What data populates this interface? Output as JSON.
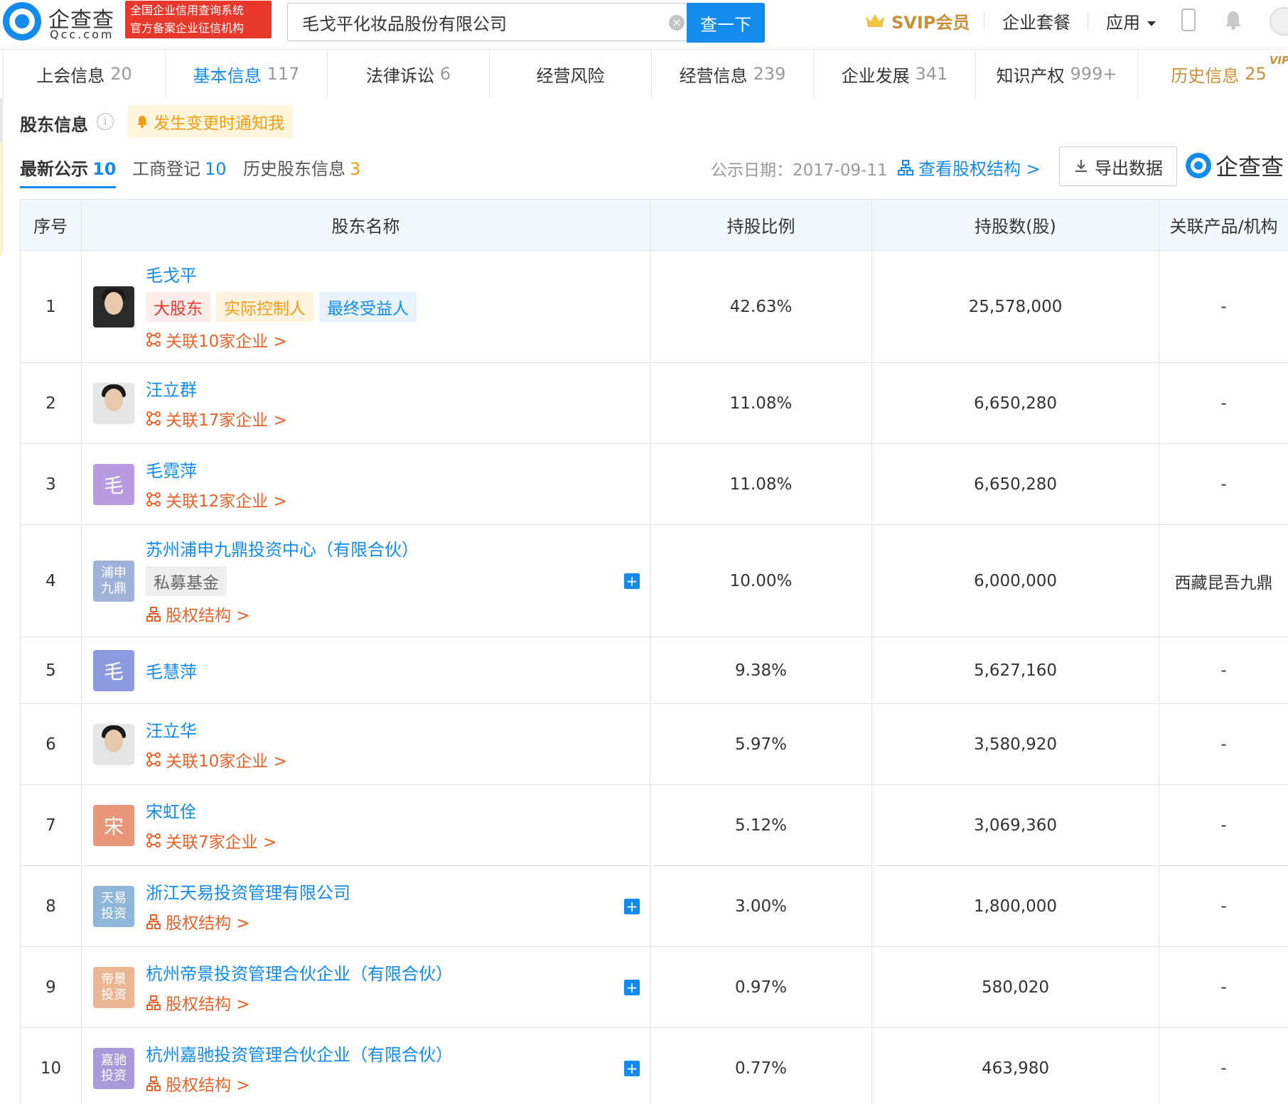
{
  "header": {
    "logo_cn": "企查查",
    "logo_en": "Qcc.com",
    "badge_line1": "全国企业信用查询系统",
    "badge_line2": "官方备案企业征信机构",
    "search_value": "毛戈平化妆品股份有限公司",
    "search_button": "查一下",
    "svip_label": "SVIP会员",
    "package_label": "企业套餐",
    "apps_label": "应用"
  },
  "tabs": [
    {
      "label": "上会信息",
      "count": "20"
    },
    {
      "label": "基本信息",
      "count": "117"
    },
    {
      "label": "法律诉讼",
      "count": "6"
    },
    {
      "label": "经营风险",
      "count": ""
    },
    {
      "label": "经营信息",
      "count": "239"
    },
    {
      "label": "企业发展",
      "count": "341"
    },
    {
      "label": "知识产权",
      "count": "999+"
    },
    {
      "label": "历史信息",
      "count": "25",
      "vip": "VIP"
    }
  ],
  "section": {
    "title": "股东信息",
    "info_symbol": "i",
    "notify": "发生变更时通知我"
  },
  "subtabs": {
    "latest": {
      "label": "最新公示",
      "count": "10"
    },
    "registry": {
      "label": "工商登记",
      "count": "10"
    },
    "history": {
      "label": "历史股东信息",
      "count": "3"
    },
    "date": "公示日期：2017-09-11",
    "equity_link": "查看股权结构 >",
    "export": "导出数据",
    "watermark": "企查查"
  },
  "table": {
    "headers": [
      "序号",
      "股东名称",
      "持股比例",
      "持股数(股)",
      "关联产品/机构"
    ],
    "rows": [
      {
        "idx": "1",
        "name": "毛戈平",
        "tags": [
          {
            "text": "大股东",
            "color": "red"
          },
          {
            "text": "实际控制人",
            "color": "orange"
          },
          {
            "text": "最终受益人",
            "color": "blue"
          }
        ],
        "link": "关联10家企业 >",
        "ratio": "42.63%",
        "shares": "25,578,000",
        "rel": "-",
        "avatar": "photo",
        "plus": false
      },
      {
        "idx": "2",
        "name": "汪立群",
        "tags": [],
        "link": "关联17家企业 >",
        "ratio": "11.08%",
        "shares": "6,650,280",
        "rel": "-",
        "avatar": "photo-light",
        "plus": false
      },
      {
        "idx": "3",
        "name": "毛霓萍",
        "tags": [],
        "link": "关联12家企业 >",
        "ratio": "11.08%",
        "shares": "6,650,280",
        "rel": "-",
        "avatar": "char",
        "avatar_text": "毛",
        "avatar_color": "#b99be0",
        "plus": false
      },
      {
        "idx": "4",
        "name": "苏州浦申九鼎投资中心（有限合伙）",
        "tags": [
          {
            "text": "私募基金",
            "color": "gray"
          }
        ],
        "link": "股权结构 >",
        "link_type": "equity",
        "ratio": "10.00%",
        "shares": "6,000,000",
        "rel": "西藏昆吾九鼎",
        "avatar": "org",
        "avatar_line1": "浦申",
        "avatar_line2": "九鼎",
        "avatar_color": "#9fb3d9",
        "plus": true
      },
      {
        "idx": "5",
        "name": "毛慧萍",
        "tags": [],
        "link": "",
        "ratio": "9.38%",
        "shares": "5,627,160",
        "rel": "-",
        "avatar": "char",
        "avatar_text": "毛",
        "avatar_color": "#8c9be0",
        "plus": false
      },
      {
        "idx": "6",
        "name": "汪立华",
        "tags": [],
        "link": "关联10家企业 >",
        "ratio": "5.97%",
        "shares": "3,580,920",
        "rel": "-",
        "avatar": "photo-light",
        "plus": false
      },
      {
        "idx": "7",
        "name": "宋虹佺",
        "tags": [],
        "link": "关联7家企业 >",
        "ratio": "5.12%",
        "shares": "3,069,360",
        "rel": "-",
        "avatar": "char",
        "avatar_text": "宋",
        "avatar_color": "#e8977a",
        "plus": false
      },
      {
        "idx": "8",
        "name": "浙江天易投资管理有限公司",
        "tags": [],
        "link": "股权结构 >",
        "link_type": "equity",
        "ratio": "3.00%",
        "shares": "1,800,000",
        "rel": "-",
        "avatar": "org",
        "avatar_line1": "天易",
        "avatar_line2": "投资",
        "avatar_color": "#8fb5d8",
        "plus": true
      },
      {
        "idx": "9",
        "name": "杭州帝景投资管理合伙企业（有限合伙）",
        "tags": [],
        "link": "股权结构 >",
        "link_type": "equity",
        "ratio": "0.97%",
        "shares": "580,020",
        "rel": "-",
        "avatar": "org",
        "avatar_line1": "帝景",
        "avatar_line2": "投资",
        "avatar_color": "#ecb694",
        "plus": true
      },
      {
        "idx": "10",
        "name": "杭州嘉驰投资管理合伙企业（有限合伙）",
        "tags": [],
        "link": "股权结构 >",
        "link_type": "equity",
        "ratio": "0.77%",
        "shares": "463,980",
        "rel": "-",
        "avatar": "org",
        "avatar_line1": "嘉驰",
        "avatar_line2": "投资",
        "avatar_color": "#a89ad9",
        "plus": true
      }
    ]
  },
  "colors": {
    "primary": "#128bed",
    "link_orange": "#e8622b",
    "gold": "#c7913a"
  }
}
